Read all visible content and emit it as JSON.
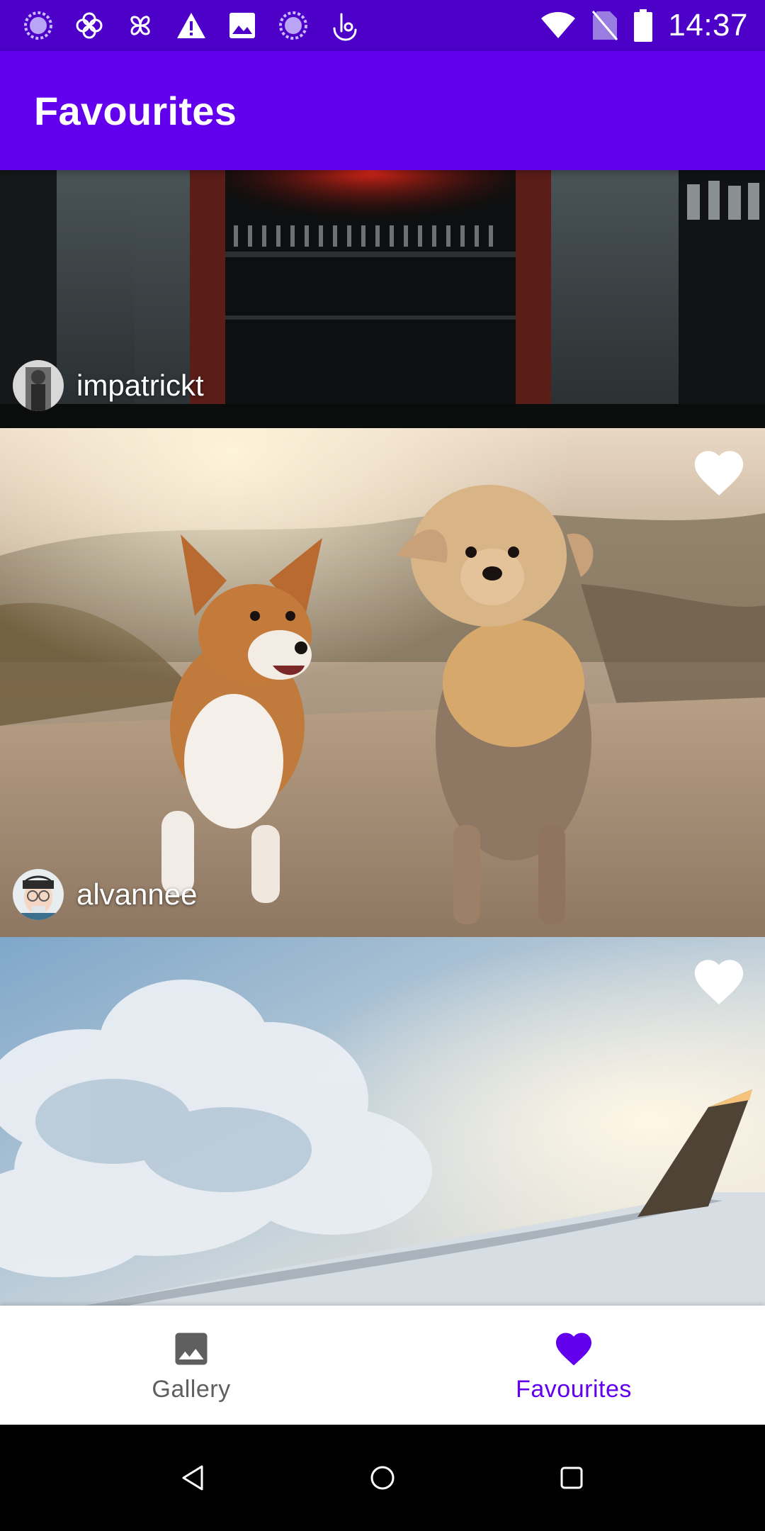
{
  "status_bar": {
    "time": "14:37",
    "left_icons": [
      "loading-circle-icon",
      "flower-icon",
      "pinwheel-icon",
      "warning-icon",
      "image-icon",
      "loading-circle-icon",
      "touch-icon"
    ],
    "right_icons": [
      "wifi-icon",
      "no-sim-icon",
      "battery-icon"
    ]
  },
  "app_bar": {
    "title": "Favourites"
  },
  "feed": [
    {
      "author": "impatrickt",
      "image": "bar-storefront",
      "favourited": true
    },
    {
      "author": "alvannee",
      "image": "dogs-running",
      "favourited": true
    },
    {
      "author": "",
      "image": "airplane-wing-clouds",
      "favourited": true
    }
  ],
  "bottom_nav": {
    "items": [
      {
        "label": "Gallery",
        "icon": "image-icon",
        "selected": false
      },
      {
        "label": "Favourites",
        "icon": "heart-icon",
        "selected": true
      }
    ]
  },
  "system_nav": {
    "icons": [
      "back-icon",
      "home-icon",
      "recents-icon"
    ]
  },
  "colors": {
    "status_bar": "#4c00c8",
    "app_bar": "#6200ee",
    "accent": "#6200ee",
    "inactive": "#5f5f5f"
  }
}
